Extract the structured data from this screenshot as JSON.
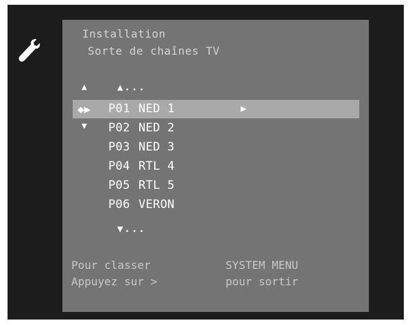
{
  "menu": {
    "title": "Installation",
    "subtitle": "Sorte de chaînes TV"
  },
  "nav": {
    "up_arrow": "▲",
    "up_more": "▲...",
    "down_arrow": "▼",
    "down_more": "▼...",
    "selected_markers": "◆▶",
    "selected_right_arrow": "▶"
  },
  "channels": [
    {
      "num": "P01",
      "name": "NED 1"
    },
    {
      "num": "P02",
      "name": "NED 2"
    },
    {
      "num": "P03",
      "name": "NED 3"
    },
    {
      "num": "P04",
      "name": "RTL 4"
    },
    {
      "num": "P05",
      "name": "RTL 5"
    },
    {
      "num": "P06",
      "name": "VERON"
    }
  ],
  "footer": {
    "left_line1": "Pour classer",
    "left_line2": "Appuyez sur  >",
    "right_line1": "SYSTEM MENU",
    "right_line2": "pour sortir"
  },
  "icons": {
    "settings": "wrench-icon"
  },
  "colors": {
    "screen_bg": "#1c1c1c",
    "panel_bg": "#747474",
    "highlight_bg": "#a9a9a9",
    "text": "#ffffff"
  }
}
